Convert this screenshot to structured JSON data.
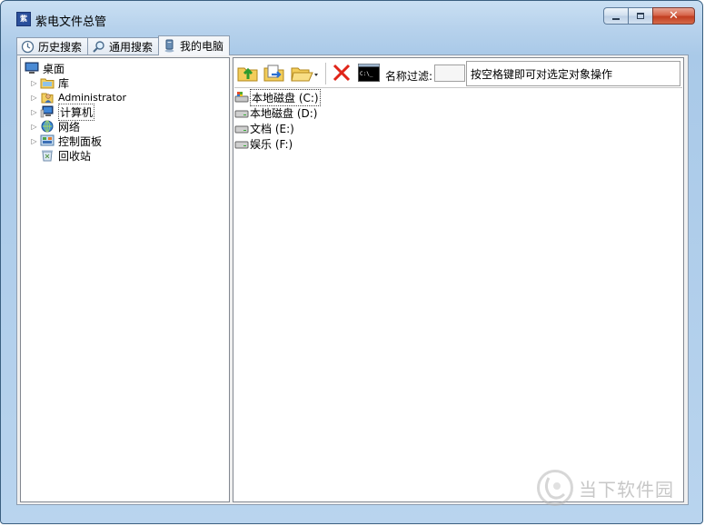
{
  "window": {
    "title": "紫电文件总管",
    "icon": "app-icon"
  },
  "tabs": [
    {
      "label": "历史搜索",
      "icon": "history-icon",
      "active": false
    },
    {
      "label": "通用搜索",
      "icon": "search-icon",
      "active": false
    },
    {
      "label": "我的电脑",
      "icon": "computer-icon",
      "active": true
    }
  ],
  "tree": [
    {
      "label": "桌面",
      "icon": "desktop-icon"
    },
    {
      "label": "库",
      "icon": "library-icon"
    },
    {
      "label": "Administrator",
      "icon": "user-folder-icon"
    },
    {
      "label": "计算机",
      "icon": "computer-icon",
      "selected": true
    },
    {
      "label": "网络",
      "icon": "network-icon"
    },
    {
      "label": "控制面板",
      "icon": "control-panel-icon"
    },
    {
      "label": "回收站",
      "icon": "recycle-bin-icon"
    }
  ],
  "toolbar": {
    "filter_label": "名称过滤:",
    "filter_value": "",
    "hint": "按空格键即可对选定对象操作"
  },
  "drives": [
    {
      "label": "本地磁盘 (C:)",
      "icon": "system-drive-icon",
      "selected": true
    },
    {
      "label": "本地磁盘 (D:)",
      "icon": "drive-icon"
    },
    {
      "label": "文档 (E:)",
      "icon": "drive-icon"
    },
    {
      "label": "娱乐 (F:)",
      "icon": "drive-icon"
    }
  ],
  "watermark": {
    "text": "当下软件园"
  },
  "colors": {
    "accent": "#3a5f80",
    "close": "#c13e21",
    "selection": "#cfe3fc"
  }
}
